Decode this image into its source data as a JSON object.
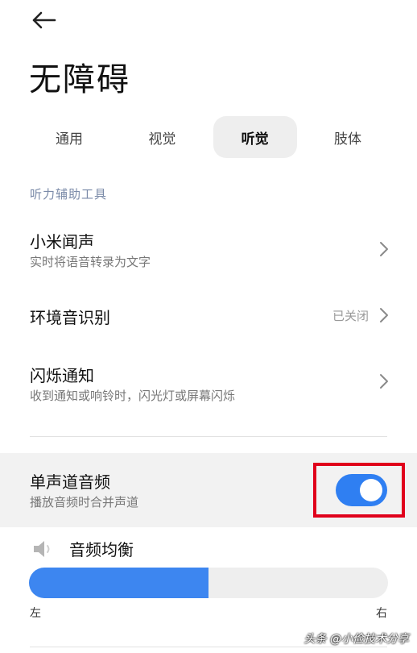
{
  "header": {
    "back_icon": "arrow-left-icon",
    "title": "无障碍"
  },
  "tabs": [
    {
      "label": "通用",
      "active": false
    },
    {
      "label": "视觉",
      "active": false
    },
    {
      "label": "听觉",
      "active": true
    },
    {
      "label": "肢体",
      "active": false
    }
  ],
  "section": {
    "header": "听力辅助工具"
  },
  "items": {
    "xiaomi_voice": {
      "title": "小米闻声",
      "subtitle": "实时将语音转录为文字"
    },
    "env_sound": {
      "title": "环境音识别",
      "value": "已关闭"
    },
    "flash_notify": {
      "title": "闪烁通知",
      "subtitle": "收到通知或响铃时，闪光灯或屏幕闪烁"
    },
    "mono_audio": {
      "title": "单声道音频",
      "subtitle": "播放音频时合并声道",
      "enabled": true
    }
  },
  "balance": {
    "title": "音频均衡",
    "icon": "speaker-icon",
    "left_label": "左",
    "right_label": "右",
    "level_fraction": 0.5
  },
  "colors": {
    "accent": "#2f7ff2",
    "highlight_box": "#e0001b"
  },
  "watermark": "头条 @小俭技术分享"
}
